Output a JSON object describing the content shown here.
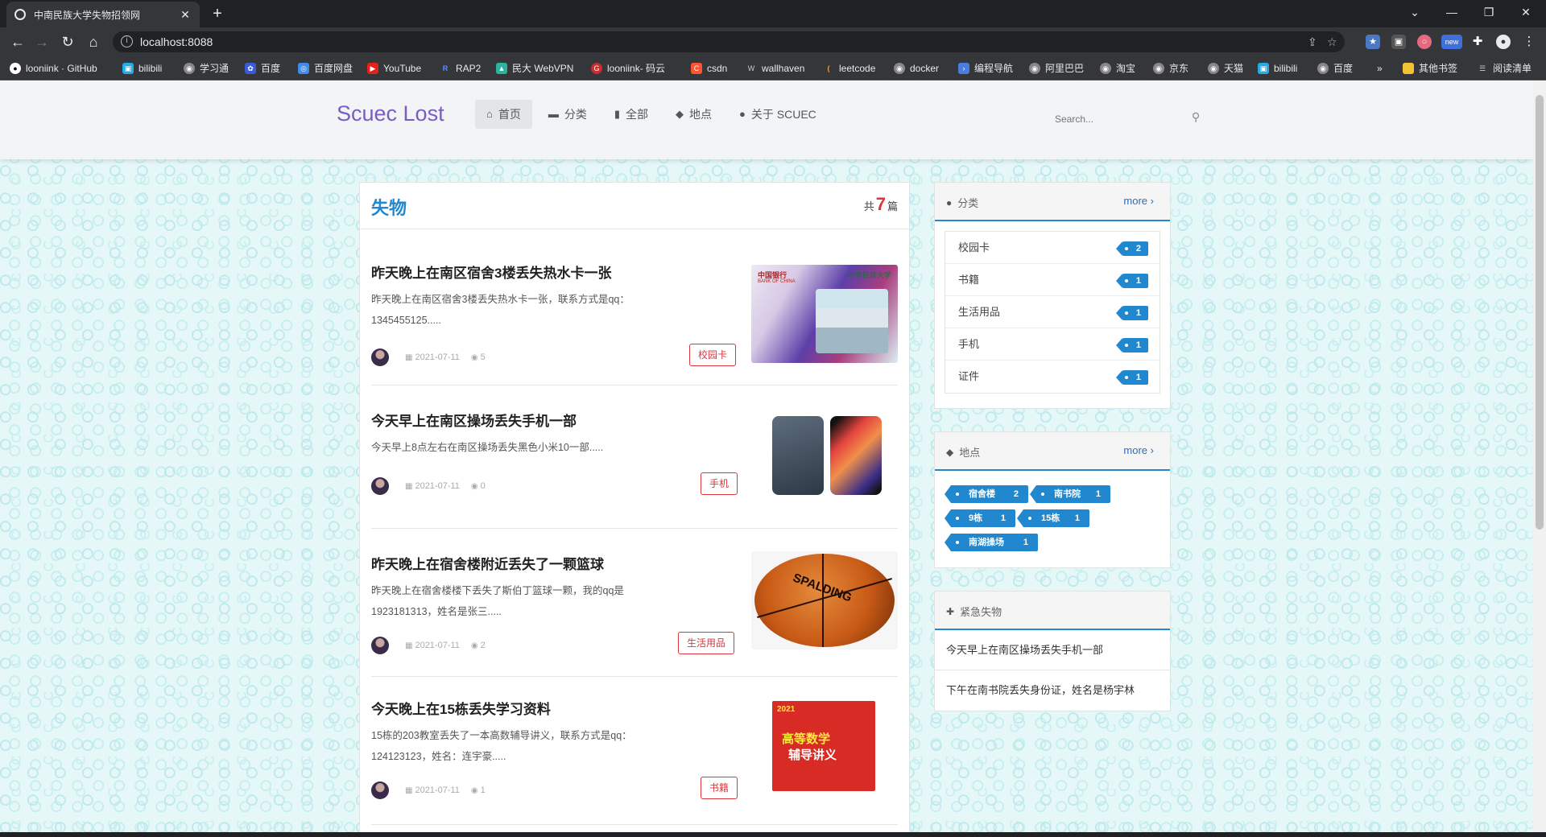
{
  "browser": {
    "tab_title": "中南民族大学失物招领网",
    "url": "localhost:8088",
    "bookmarks": [
      "looniink · GitHub",
      "bilibili",
      "学习通",
      "百度",
      "百度网盘",
      "YouTube",
      "RAP2",
      "民大 WebVPN",
      "looniink- 码云",
      "csdn",
      "wallhaven",
      "leetcode",
      "docker",
      "编程导航",
      "阿里巴巴",
      "淘宝",
      "京东",
      "天猫",
      "bilibili",
      "百度"
    ],
    "bookmarks_more": "»",
    "other_bookmarks": "其他书签",
    "reading_list": "阅读清单",
    "ext_new_label": "new"
  },
  "header": {
    "brand": "Scuec Lost",
    "nav": [
      {
        "icon": "home-icon",
        "label": "首页"
      },
      {
        "icon": "folder-icon",
        "label": "分类"
      },
      {
        "icon": "file-icon",
        "label": "全部"
      },
      {
        "icon": "tags-icon",
        "label": "地点"
      },
      {
        "icon": "user-icon",
        "label": "关于 SCUEC"
      }
    ],
    "search_placeholder": "Search..."
  },
  "main": {
    "title": "失物",
    "count_prefix": "共",
    "count": "7",
    "count_suffix": "篇",
    "posts": [
      {
        "title": "昨天晚上在南区宿舍3楼丢失热水卡一张",
        "desc": "昨天晚上在南区宿舍3楼丢失热水卡一张，联系方式是qq：1345455125.....",
        "date": "2021-07-11",
        "views": "5",
        "tag": "校园卡",
        "thumb_bank": "中国银行",
        "thumb_bank_en": "BANK OF CHINA",
        "thumb_school": "中南民族大学"
      },
      {
        "title": "今天早上在南区操场丢失手机一部",
        "desc": "今天早上8点左右在南区操场丢失黑色小米10一部.....",
        "date": "2021-07-11",
        "views": "0",
        "tag": "手机"
      },
      {
        "title": "昨天晚上在宿舍楼附近丢失了一颗篮球",
        "desc": "昨天晚上在宿舍楼楼下丢失了斯伯丁篮球一颗，我的qq是1923181313，姓名是张三.....",
        "date": "2021-07-11",
        "views": "2",
        "tag": "生活用品",
        "thumb_text": "SPALDING"
      },
      {
        "title": "今天晚上在15栋丢失学习资料",
        "desc": "15栋的203教室丢失了一本高数辅导讲义，联系方式是qq：124123123，姓名：连宇豪.....",
        "date": "2021-07-11",
        "views": "1",
        "tag": "书籍",
        "thumb_year": "2021",
        "thumb_line1": "高等数学",
        "thumb_line2": "辅导讲义"
      }
    ]
  },
  "sidebar": {
    "categories": {
      "title": "分类",
      "more": "more",
      "items": [
        {
          "label": "校园卡",
          "count": "2"
        },
        {
          "label": "书籍",
          "count": "1"
        },
        {
          "label": "生活用品",
          "count": "1"
        },
        {
          "label": "手机",
          "count": "1"
        },
        {
          "label": "证件",
          "count": "1"
        }
      ]
    },
    "locations": {
      "title": "地点",
      "more": "more",
      "items": [
        {
          "label": "宿舍楼",
          "count": "2"
        },
        {
          "label": "南书院",
          "count": "1"
        },
        {
          "label": "9栋",
          "count": "1"
        },
        {
          "label": "15栋",
          "count": "1"
        },
        {
          "label": "南湖操场",
          "count": "1"
        }
      ]
    },
    "urgent": {
      "title": "紧急失物",
      "items": [
        "今天早上在南区操场丢失手机一部",
        "下午在南书院丢失身份证，姓名是杨宇林"
      ]
    }
  },
  "colors": {
    "brand": "#7b5cc4",
    "accent": "#2188cf",
    "tag_red": "#d9363b"
  }
}
